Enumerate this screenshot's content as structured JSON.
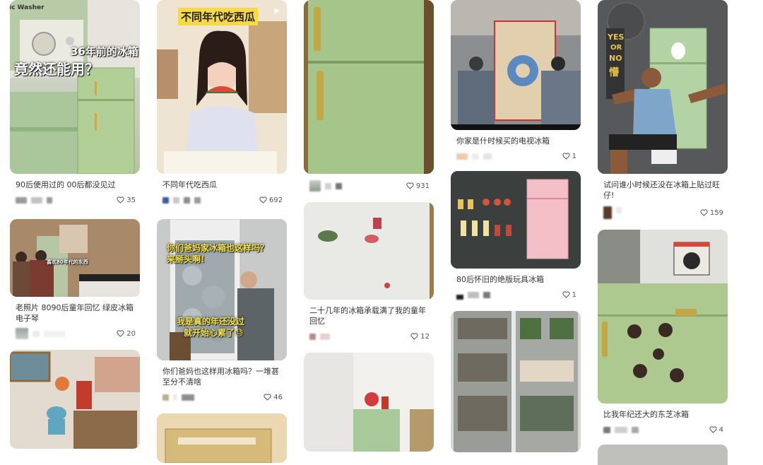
{
  "posts": [
    {
      "title": "90后使用过的 00后都没见过",
      "likes": "35",
      "overlay1": "36年前的冰箱",
      "overlay2": "竟然还能用？",
      "overlay3": "ic Washer"
    },
    {
      "title": "老照片 8090后童年回忆 绿皮冰箱电子琴",
      "likes": "20",
      "overlay1": "喜欢80年代的东西"
    },
    {
      "title": "",
      "likes": ""
    },
    {
      "title": "不同年代吃西瓜",
      "likes": "692",
      "overlay1": "不同年代吃西瓜"
    },
    {
      "title": "你们爸妈也这样用冰箱吗？一堆甚至分不清啥",
      "likes": "46",
      "overlay1": "你们爸妈家冰箱也这样吗？",
      "overlay1b": "来掰头啊！",
      "overlay2": "我是真的年还没过",
      "overlay2b": "就开始心累了😓"
    },
    {
      "title": "",
      "likes": ""
    },
    {
      "title": "",
      "likes": "931"
    },
    {
      "title": "二十几年的冰箱承载满了我的童年回忆",
      "likes": "12"
    },
    {
      "title": "",
      "likes": ""
    },
    {
      "title": "你家是什时候买的电视冰箱",
      "likes": "1"
    },
    {
      "title": "80后怀旧的绝版玩具冰箱",
      "likes": "1"
    },
    {
      "title": "",
      "likes": ""
    },
    {
      "title": "试问谁小时候还没在冰箱上贴过旺仔!",
      "likes": "159",
      "overlay1": "YES",
      "overlay2": "OR",
      "overlay3": "NO",
      "overlay4": "懵"
    },
    {
      "title": "比我年纪还大的东芝冰箱",
      "likes": "4"
    },
    {
      "title": "",
      "likes": ""
    }
  ],
  "colors": {
    "accent": "#333333",
    "meta": "#555555"
  }
}
